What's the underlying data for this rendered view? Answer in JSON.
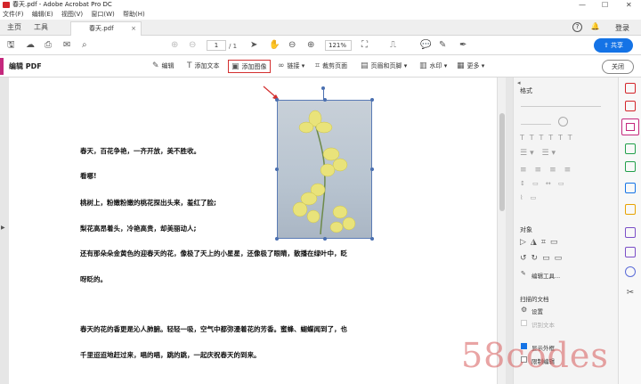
{
  "window": {
    "title": "春天.pdf - Adobe Acrobat Pro DC",
    "min": "—",
    "max": "☐",
    "close": "✕"
  },
  "menu": [
    "文件(F)",
    "编辑(E)",
    "视图(V)",
    "窗口(W)",
    "帮助(H)"
  ],
  "tabs": {
    "home": "主页",
    "tools": "工具",
    "document": "春天.pdf",
    "close": "×"
  },
  "header": {
    "help": "?",
    "bell": "🔔",
    "login": "登录"
  },
  "toolbar": {
    "page_current": "1",
    "page_total": "/ 1",
    "zoom": "121%",
    "share": "共享"
  },
  "editbar": {
    "title": "编辑 PDF",
    "buttons": [
      "编辑",
      "添加文本",
      "添加图像",
      "链接",
      "裁剪页面",
      "页眉和页脚",
      "水印",
      "更多"
    ],
    "close": "关闭"
  },
  "document": {
    "lines": [
      "春天，百花争艳，一齐开放，美不胜收。",
      "看哪!",
      "桃树上，粉嫩粉嫩的桃花探出头来，羞红了脸;",
      "梨花高昂着头，冷艳高贵，却美丽动人;",
      "还有那朵朵金黄色的迎春天的花，像极了天上的小星星，还像极了眼睛，散播在绿叶中，眨",
      "呀眨的。",
      "春天的花的香更是沁人肺腑。轻轻一吸，空气中都弥漫着花的芳香。蜜蜂、蝴蝶闻到了，也",
      "千里迢迢地赶过来，唱的唱，跳的跳，一起庆祝春天的到来。"
    ]
  },
  "format_panel": {
    "heading": "格式",
    "objects": "对象",
    "edit_tool": "编辑工具...",
    "scanned": "扫描的文档",
    "settings": "设置",
    "recognize": "识别文本",
    "show_outline": "显示外框",
    "restrict": "限制编辑"
  },
  "watermark": "58codes",
  "colors": {
    "accent": "#1473e6",
    "edit_magenta": "#c4287d",
    "highlight": "#d32f2f"
  }
}
